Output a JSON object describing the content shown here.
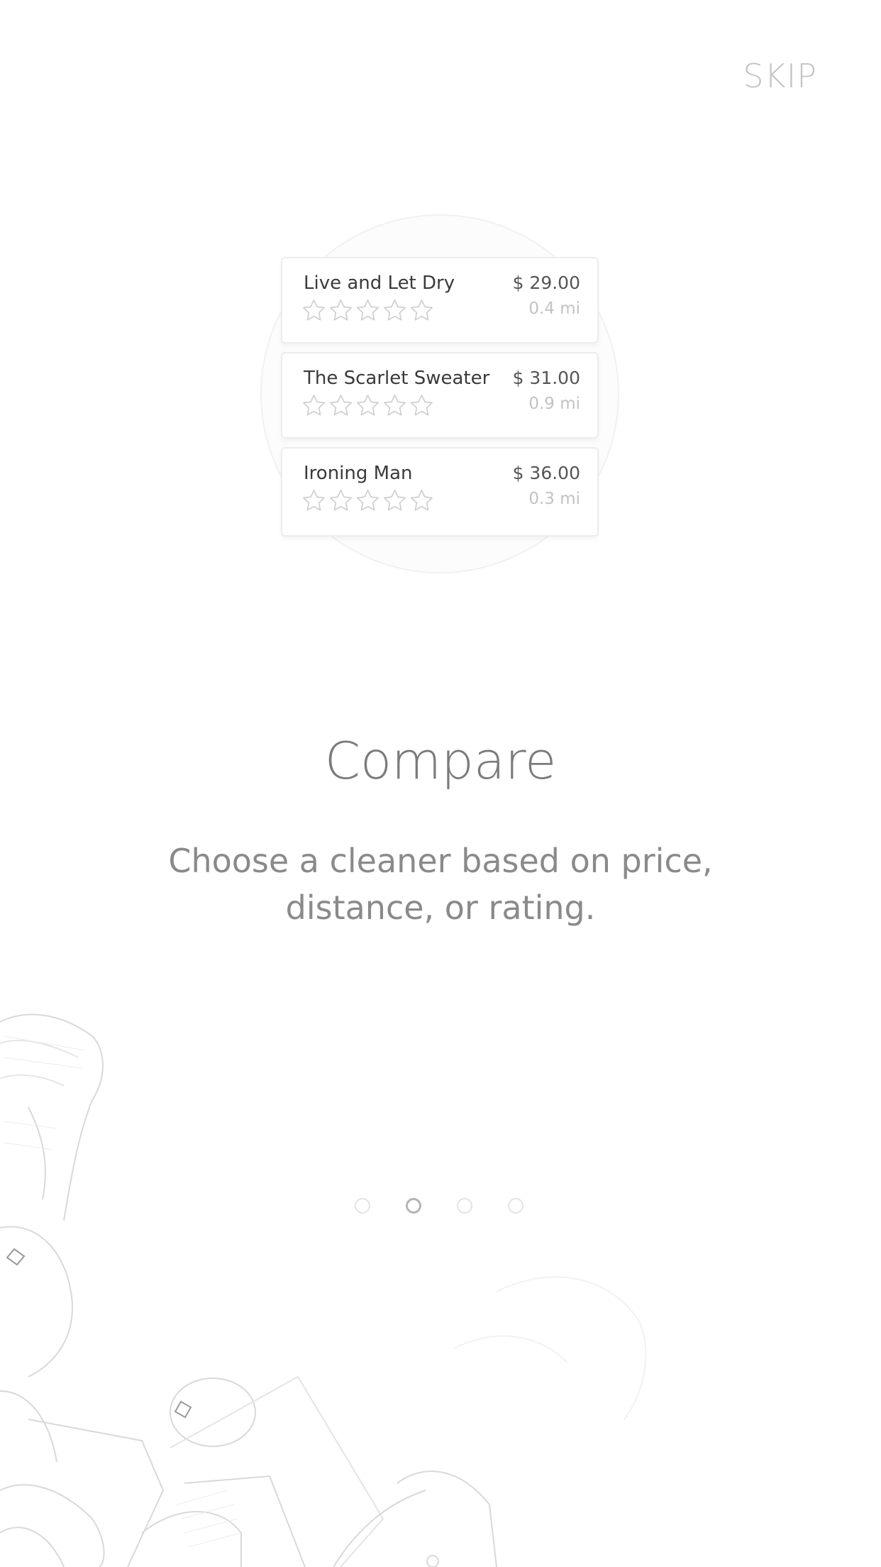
{
  "header": {
    "skip_label": "SKIP"
  },
  "illustration": {
    "cleaners": [
      {
        "name": "Live and Let Dry",
        "price": "$ 29.00",
        "distance": "0.4 mi",
        "rating_stars": 0
      },
      {
        "name": "The Scarlet Sweater",
        "price": "$ 31.00",
        "distance": "0.9 mi",
        "rating_stars": 0
      },
      {
        "name": "Ironing Man",
        "price": "$ 36.00",
        "distance": "0.3 mi",
        "rating_stars": 0
      }
    ],
    "max_stars": 5,
    "star_icon": "star-outline-icon"
  },
  "onboarding": {
    "title": "Compare",
    "description": "Choose a cleaner based on price, distance, or rating."
  },
  "pager": {
    "page_count": 4,
    "current_page": 2
  },
  "colors": {
    "background": "#ffffff",
    "text_muted": "#8a8a8a",
    "skip": "#c4c4c4"
  }
}
